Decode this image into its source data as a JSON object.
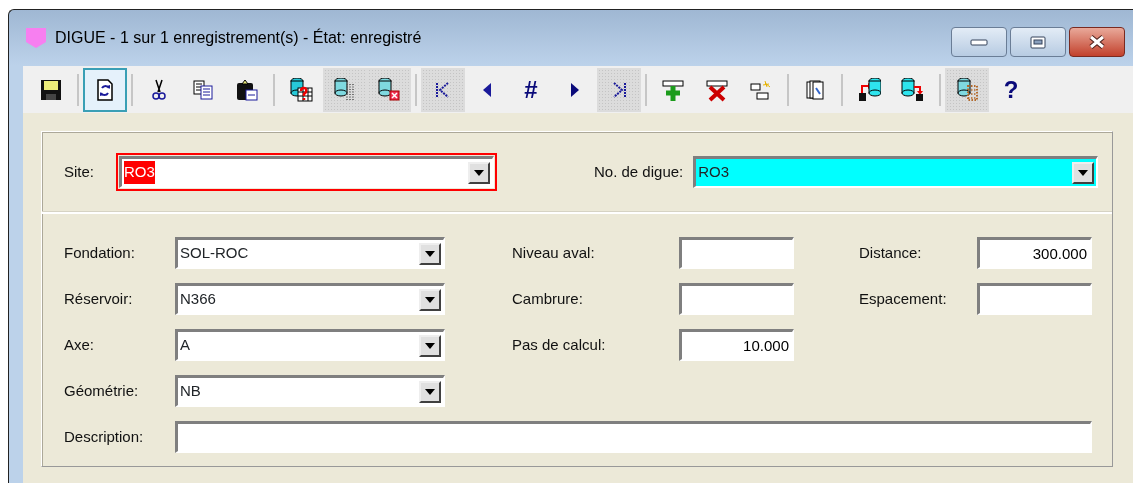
{
  "window": {
    "title": "DIGUE - 1 sur 1 enregistrement(s) - État: enregistré",
    "buttons": [
      {
        "kind": "minimize"
      },
      {
        "kind": "maximize"
      },
      {
        "kind": "close"
      }
    ]
  },
  "toolbar": [
    {
      "kind": "save",
      "disabled": false,
      "selected": false
    },
    {
      "kind": "separator"
    },
    {
      "kind": "refresh",
      "disabled": false,
      "selected": true
    },
    {
      "kind": "separator"
    },
    {
      "kind": "cut",
      "disabled": false,
      "selected": false
    },
    {
      "kind": "copy",
      "disabled": false,
      "selected": false
    },
    {
      "kind": "paste",
      "disabled": false,
      "selected": false
    },
    {
      "kind": "separator"
    },
    {
      "kind": "db-query",
      "disabled": false,
      "selected": false
    },
    {
      "kind": "db-filter",
      "disabled": true,
      "selected": false
    },
    {
      "kind": "db-delete",
      "disabled": true,
      "selected": false
    },
    {
      "kind": "separator"
    },
    {
      "kind": "first",
      "disabled": true,
      "selected": false
    },
    {
      "kind": "prev",
      "disabled": false,
      "selected": false
    },
    {
      "kind": "goto",
      "label": "#",
      "disabled": false,
      "selected": false
    },
    {
      "kind": "next",
      "disabled": false,
      "selected": false
    },
    {
      "kind": "last",
      "disabled": true,
      "selected": false
    },
    {
      "kind": "separator"
    },
    {
      "kind": "add",
      "disabled": false,
      "selected": false
    },
    {
      "kind": "delete",
      "disabled": false,
      "selected": false
    },
    {
      "kind": "edit",
      "disabled": false,
      "selected": false
    },
    {
      "kind": "separator"
    },
    {
      "kind": "pages",
      "disabled": false,
      "selected": false
    },
    {
      "kind": "separator"
    },
    {
      "kind": "import",
      "disabled": false,
      "selected": false
    },
    {
      "kind": "export",
      "disabled": false,
      "selected": false
    },
    {
      "kind": "separator"
    },
    {
      "kind": "db-grid",
      "disabled": true,
      "selected": false
    },
    {
      "kind": "help",
      "label": "?",
      "disabled": false,
      "selected": false
    }
  ],
  "header_fields": [
    {
      "label": "Site:",
      "value": "RO3",
      "focused": true,
      "highlighted": false
    },
    {
      "label": "No. de digue:",
      "value": "RO3",
      "focused": false,
      "highlighted": true
    }
  ],
  "left_fields": [
    {
      "label": "Fondation:",
      "value": "SOL-ROC"
    },
    {
      "label": "Réservoir:",
      "value": "N366"
    },
    {
      "label": "Axe:",
      "value": "A"
    },
    {
      "label": "Géométrie:",
      "value": "NB"
    }
  ],
  "middle_fields": [
    {
      "label": "Niveau aval:"
    },
    {
      "label": "Cambrure:"
    },
    {
      "label": "Pas de calcul:",
      "value": "10.000"
    }
  ],
  "right_fields": [
    {
      "label": "Distance:",
      "value": "300.000"
    },
    {
      "label": "Espacement:"
    }
  ],
  "description": {
    "label": "Description:"
  }
}
